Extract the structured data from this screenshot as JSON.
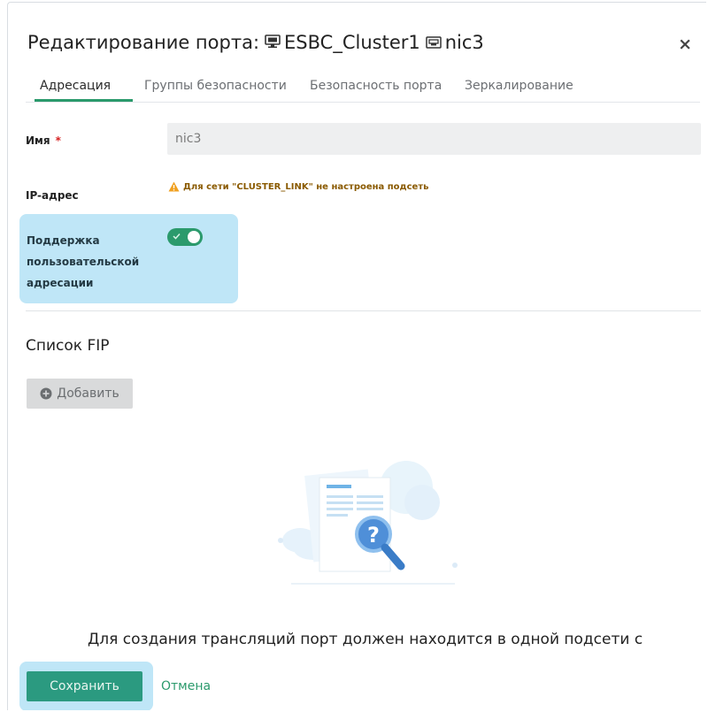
{
  "dialog": {
    "title_prefix": "Редактирование порта:",
    "vm_name": "ESBC_Cluster1",
    "port_name": "nic3",
    "close_label": "×"
  },
  "tabs": [
    {
      "label": "Адресация",
      "active": true
    },
    {
      "label": "Группы безопасности",
      "active": false
    },
    {
      "label": "Безопасность порта",
      "active": false
    },
    {
      "label": "Зеркалирование",
      "active": false
    }
  ],
  "form": {
    "name_label": "Имя",
    "required_mark": "*",
    "name_value": "nic3",
    "ip_label": "IP-адрес",
    "ip_warning": "Для сети \"CLUSTER_LINK\" не настроена подсеть",
    "custom_addressing_label": "Поддержка пользовательской адресации",
    "custom_addressing_enabled": true
  },
  "fip": {
    "title": "Список FIP",
    "add_label": "Добавить",
    "empty_message": "Для создания трансляций порт должен находится в одной подсети с"
  },
  "footer": {
    "save_label": "Сохранить",
    "cancel_label": "Отмена"
  },
  "colors": {
    "accent": "#2b9a6c",
    "highlight": "#bfe6f7",
    "warning": "#f0a020"
  },
  "icons": {
    "vm": "monitor-icon",
    "port": "network-port-icon",
    "warning": "warning-icon",
    "add": "plus-circle-icon",
    "empty": "empty-search-illustration"
  }
}
